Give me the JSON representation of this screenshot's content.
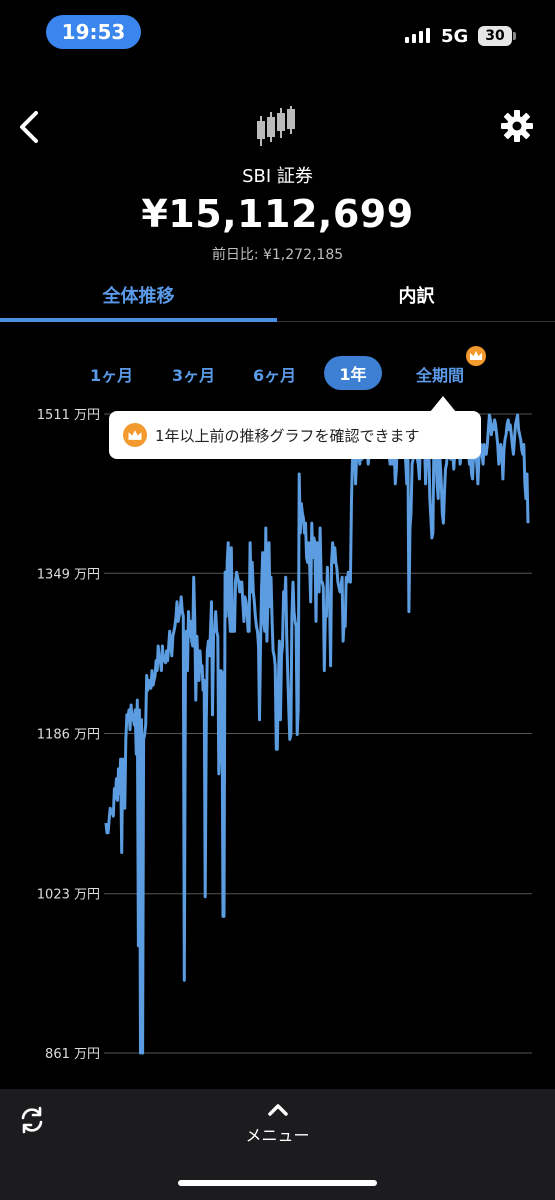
{
  "status_bar": {
    "time": "19:53",
    "network": "5G",
    "battery": "30"
  },
  "header": {
    "broker": "SBI 証券",
    "total": "¥15,112,699",
    "change": "前日比: ¥1,272,185",
    "icons": {
      "back": "chevron-left-icon",
      "settings": "gear-icon",
      "logo": "candlestick-icon"
    }
  },
  "tabs": [
    {
      "label": "全体推移"
    },
    {
      "label": "内訳"
    }
  ],
  "ranges": [
    {
      "label": "1ヶ月"
    },
    {
      "label": "3ヶ月"
    },
    {
      "label": "6ヶ月"
    },
    {
      "label": "1年"
    },
    {
      "label": "全期間"
    }
  ],
  "tooltip": {
    "text": "1年以上前の推移グラフを確認できます"
  },
  "bottom_bar": {
    "menu_label": "メニュー"
  },
  "colors": {
    "accent": "#4a90e2",
    "line": "#5b9de0",
    "crown": "#f29a2e"
  },
  "chart_data": {
    "type": "line",
    "ylabel_unit": "万円",
    "yticks": [
      1511,
      1349,
      1186,
      1023,
      861
    ],
    "ytick_labels": [
      "1511 万円",
      "1349 万円",
      "1186 万円",
      "1023 万円",
      "861 万円"
    ],
    "ylim": [
      861,
      1511
    ],
    "grid": true,
    "series": [
      {
        "values": [
          1095,
          1085,
          1085,
          1098,
          1110,
          1105,
          1108,
          1102,
          1130,
          1120,
          1140,
          1118,
          1150,
          1125,
          1160,
          1065,
          1160,
          1140,
          1110,
          1180,
          1205,
          1200,
          1210,
          1190,
          1215,
          1200,
          1205,
          1195,
          1210,
          1165,
          1220,
          970,
          1210,
          861,
          1200,
          861,
          1180,
          1185,
          1195,
          1245,
          1230,
          1240,
          1238,
          1232,
          1250,
          1235,
          1240,
          1245,
          1260,
          1250,
          1275,
          1262,
          1260,
          1250,
          1275,
          1260,
          1262,
          1258,
          1270,
          1260,
          1275,
          1290,
          1278,
          1265,
          1285,
          1290,
          1295,
          1305,
          1320,
          1300,
          1305,
          1312,
          1325,
          1310,
          1305,
          935,
          1245,
          1290,
          1250,
          1310,
          1285,
          1300,
          1280,
          1275,
          1345,
          1300,
          1220,
          1285,
          1260,
          1240,
          1270,
          1250,
          1255,
          1230,
          1240,
          1020,
          1200,
          1270,
          1280,
          1265,
          1290,
          1320,
          1205,
          1290,
          1290,
          1310,
          1290,
          1285,
          1145,
          1170,
          1250,
          1248,
          1000,
          1000,
          1350,
          1305,
          1360,
          1380,
          1310,
          1290,
          1375,
          1290,
          1290,
          1290,
          1340,
          1350,
          1345,
          1340,
          1330,
          1340,
          1340,
          1320,
          1300,
          1325,
          1320,
          1310,
          1290,
          1290,
          1380,
          1330,
          1360,
          1330,
          1320,
          1305,
          1295,
          1290,
          1275,
          1200,
          1280,
          1335,
          1370,
          1300,
          1290,
          1395,
          1280,
          1320,
          1380,
          1315,
          1345,
          1300,
          1270,
          1265,
          1255,
          1170,
          1170,
          1240,
          1280,
          1200,
          1265,
          1275,
          1330,
          1320,
          1345,
          1285,
          1245,
          1210,
          1180,
          1185,
          1305,
          1340,
          1310,
          1300,
          1295,
          1185,
          1210,
          1450,
          1390,
          1420,
          1410,
          1405,
          1390,
          1400,
          1365,
          1360,
          1380,
          1355,
          1320,
          1400,
          1365,
          1385,
          1380,
          1300,
          1380,
          1340,
          1330,
          1395,
          1340,
          1340,
          1335,
          1250,
          1310,
          1305,
          1355,
          1320,
          1325,
          1255,
          1360,
          1380,
          1360,
          1375,
          1360,
          1355,
          1340,
          1335,
          1330,
          1335,
          1345,
          1280,
          1300,
          1295,
          1345,
          1340,
          1350,
          1350,
          1340,
          1425,
          1465,
          1455,
          1475,
          1440,
          1470,
          1465,
          1470,
          1460,
          1490,
          1465,
          1475,
          1475,
          1470,
          1475,
          1475,
          1460,
          1470,
          1480,
          1485,
          1500,
          1490,
          1500,
          1490,
          1495,
          1490,
          1500,
          1495,
          1510,
          1495,
          1505,
          1490,
          1480,
          1500,
          1490,
          1480,
          1470,
          1460,
          1470,
          1460,
          1465,
          1470,
          1440,
          1455,
          1490,
          1480,
          1500,
          1495,
          1505,
          1475,
          1475,
          1480,
          1460,
          1440,
          1480,
          1310,
          1395,
          1410,
          1460,
          1465,
          1485,
          1475,
          1470,
          1465,
          1460,
          1445,
          1485,
          1490,
          1475,
          1470,
          1480,
          1440,
          1470,
          1460,
          1480,
          1425,
          1405,
          1385,
          1390,
          1490,
          1500,
          1465,
          1440,
          1425,
          1480,
          1460,
          1440,
          1410,
          1400,
          1430,
          1455,
          1460,
          1475,
          1480,
          1470,
          1465,
          1480,
          1470,
          1455,
          1475,
          1495,
          1490,
          1480,
          1485,
          1460,
          1470,
          1490,
          1500,
          1505,
          1495,
          1485,
          1475,
          1470,
          1460,
          1465,
          1450,
          1445,
          1475,
          1480,
          1470,
          1460,
          1440,
          1465,
          1475,
          1480,
          1470,
          1460,
          1480,
          1475,
          1470,
          1480,
          1495,
          1510,
          1505,
          1490,
          1500,
          1495,
          1505,
          1500,
          1490,
          1480,
          1460,
          1470,
          1480,
          1470,
          1445,
          1475,
          1485,
          1490,
          1500,
          1505,
          1495,
          1500,
          1490,
          1480,
          1470,
          1485,
          1500,
          1505,
          1510,
          1495,
          1490,
          1485,
          1475,
          1470,
          1480,
          1440,
          1425,
          1450,
          1400
        ]
      }
    ]
  }
}
